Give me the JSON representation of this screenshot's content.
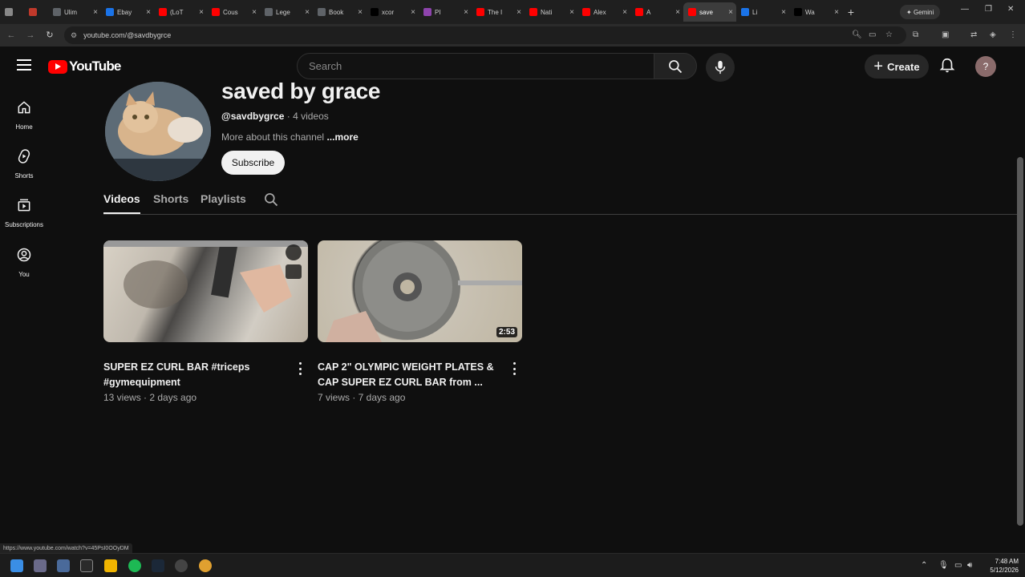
{
  "browser": {
    "tabs": [
      {
        "label": "",
        "color": "#888888"
      },
      {
        "label": "",
        "color": "#c0392b"
      },
      {
        "label": "Ulim",
        "color": "#5f6368"
      },
      {
        "label": "Ebay",
        "color": "#1a73e8"
      },
      {
        "label": "(LoT",
        "color": "#ff0000"
      },
      {
        "label": "Cous",
        "color": "#ff0000"
      },
      {
        "label": "Lege",
        "color": "#5f6368"
      },
      {
        "label": "Book",
        "color": "#5f6368"
      },
      {
        "label": "xcor",
        "color": "#000000"
      },
      {
        "label": "PI",
        "color": "#8e44ad"
      },
      {
        "label": "The I",
        "color": "#ff0000"
      },
      {
        "label": "Nati",
        "color": "#ff0000"
      },
      {
        "label": "Alex",
        "color": "#ff0000"
      },
      {
        "label": "A",
        "color": "#ff0000"
      },
      {
        "label": "save",
        "color": "#ff0000",
        "active": true
      },
      {
        "label": "Li",
        "color": "#1a73e8"
      },
      {
        "label": "Wa",
        "color": "#000000"
      }
    ],
    "new_tab": "+",
    "gemini": "Gemini",
    "url": "youtube.com/@savdbygrce",
    "status_url": "https://www.youtube.com/watch?v=45PsI0OOyDM"
  },
  "masthead": {
    "logo_text": "YouTube",
    "search_placeholder": "Search",
    "create_label": "Create",
    "avatar_letter": "?"
  },
  "guide": [
    {
      "label": "Home",
      "icon": "home-icon"
    },
    {
      "label": "Shorts",
      "icon": "shorts-icon"
    },
    {
      "label": "Subscriptions",
      "icon": "subscriptions-icon"
    },
    {
      "label": "You",
      "icon": "you-icon"
    }
  ],
  "channel": {
    "name": "saved by grace",
    "handle": "@savdbygrce",
    "video_count": "· 4 videos",
    "about": "More about this channel",
    "more": "...more",
    "subscribe": "Subscribe"
  },
  "tabs": [
    "Videos",
    "Shorts",
    "Playlists"
  ],
  "videos": [
    {
      "title": "SUPER EZ CURL BAR #triceps #gymequipment",
      "meta": "13 views · 2 days ago",
      "duration": ""
    },
    {
      "title": "CAP 2\" OLYMPIC WEIGHT PLATES & CAP SUPER EZ CURL BAR from ...",
      "meta": "7 views · 7 days ago",
      "duration": "2:53"
    }
  ],
  "taskbar": {
    "time": "7:48 AM",
    "date": "5/12/2026"
  }
}
